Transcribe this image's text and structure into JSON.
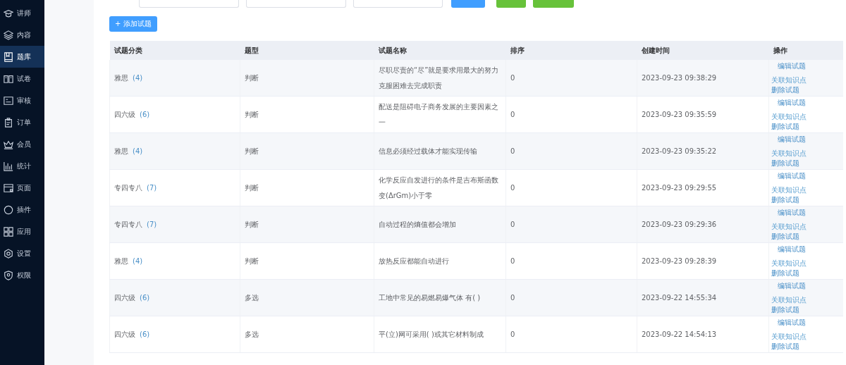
{
  "sidebar": {
    "items": [
      {
        "label": "讲师",
        "selected": false
      },
      {
        "label": "内容",
        "selected": false
      },
      {
        "label": "题库",
        "selected": true
      },
      {
        "label": "试卷",
        "selected": false
      },
      {
        "label": "审核",
        "selected": false
      },
      {
        "label": "订单",
        "selected": false
      },
      {
        "label": "会员",
        "selected": false
      },
      {
        "label": "统计",
        "selected": false
      },
      {
        "label": "页面",
        "selected": false
      },
      {
        "label": "插件",
        "selected": false
      },
      {
        "label": "应用",
        "selected": false
      },
      {
        "label": "设置",
        "selected": false
      },
      {
        "label": "权限",
        "selected": false
      }
    ]
  },
  "toolbar": {
    "add_button": "+ 添加试题"
  },
  "table": {
    "columns": [
      "试题分类",
      "题型",
      "试题名称",
      "排序",
      "创建时间",
      "操作"
    ],
    "rows": [
      {
        "category": "雅思",
        "count": "(4)",
        "type": "判断",
        "name": "尽职尽责的“尽”就是要求用最大的努力克服困难去完成职责",
        "order": "0",
        "created": "2023-09-23 09:38:29",
        "actions": [
          "编辑试题",
          "关联知识点",
          "删除试题"
        ]
      },
      {
        "category": "四六级",
        "count": "(6)",
        "type": "判断",
        "name": "配送是阻碍电子商务发展的主要因素之一",
        "order": "0",
        "created": "2023-09-23 09:35:59",
        "actions": [
          "编辑试题",
          "关联知识点",
          "删除试题"
        ]
      },
      {
        "category": "雅思",
        "count": "(4)",
        "type": "判断",
        "name": "信息必须经过载体才能实现传输",
        "order": "0",
        "created": "2023-09-23 09:35:22",
        "actions": [
          "编辑试题",
          "关联知识点",
          "删除试题"
        ]
      },
      {
        "category": "专四专八",
        "count": "(7)",
        "type": "判断",
        "name": "化学反应自发进行的条件是吉布斯函数变(ΔrGm)小于零",
        "order": "0",
        "created": "2023-09-23 09:29:55",
        "actions": [
          "编辑试题",
          "关联知识点",
          "删除试题"
        ]
      },
      {
        "category": "专四专八",
        "count": "(7)",
        "type": "判断",
        "name": "自动过程的熵值都会增加",
        "order": "0",
        "created": "2023-09-23 09:29:36",
        "actions": [
          "编辑试题",
          "关联知识点",
          "删除试题"
        ]
      },
      {
        "category": "雅思",
        "count": "(4)",
        "type": "判断",
        "name": "放热反应都能自动进行",
        "order": "0",
        "created": "2023-09-23 09:28:39",
        "actions": [
          "编辑试题",
          "关联知识点",
          "删除试题"
        ]
      },
      {
        "category": "四六级",
        "count": "(6)",
        "type": "多选",
        "name": "工地中常见的易燃易爆气体 有( )",
        "order": "0",
        "created": "2023-09-22 14:55:34",
        "actions": [
          "编辑试题",
          "关联知识点",
          "删除试题"
        ]
      },
      {
        "category": "四六级",
        "count": "(6)",
        "type": "多选",
        "name": "平(立)网可采用( )或其它材料制成",
        "order": "0",
        "created": "2023-09-22 14:54:13",
        "actions": [
          "编辑试题",
          "关联知识点",
          "删除试题"
        ]
      }
    ]
  }
}
